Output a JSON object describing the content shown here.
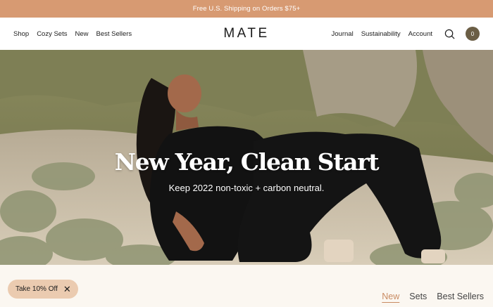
{
  "promo_bar": {
    "text": "Free U.S. Shipping on Orders $75+"
  },
  "header": {
    "nav_left": [
      "Shop",
      "Cozy Sets",
      "New",
      "Best Sellers"
    ],
    "logo": "MATE",
    "nav_right": [
      "Journal",
      "Sustainability",
      "Account"
    ],
    "cart_count": "0"
  },
  "hero": {
    "title": "New Year, Clean Start",
    "subtitle": "Keep 2022 non-toxic + carbon neutral."
  },
  "discount_pill": {
    "label": "Take 10% Off",
    "close": "✕"
  },
  "tabs": {
    "items": [
      "New",
      "Sets",
      "Best Sellers"
    ],
    "active": "New"
  },
  "colors": {
    "promo_bg": "#d79a72",
    "cart_bg": "#6b5e45",
    "accent": "#c98b62",
    "pill_bg": "#ebcbb0",
    "page_bg": "#fbf7f1"
  }
}
